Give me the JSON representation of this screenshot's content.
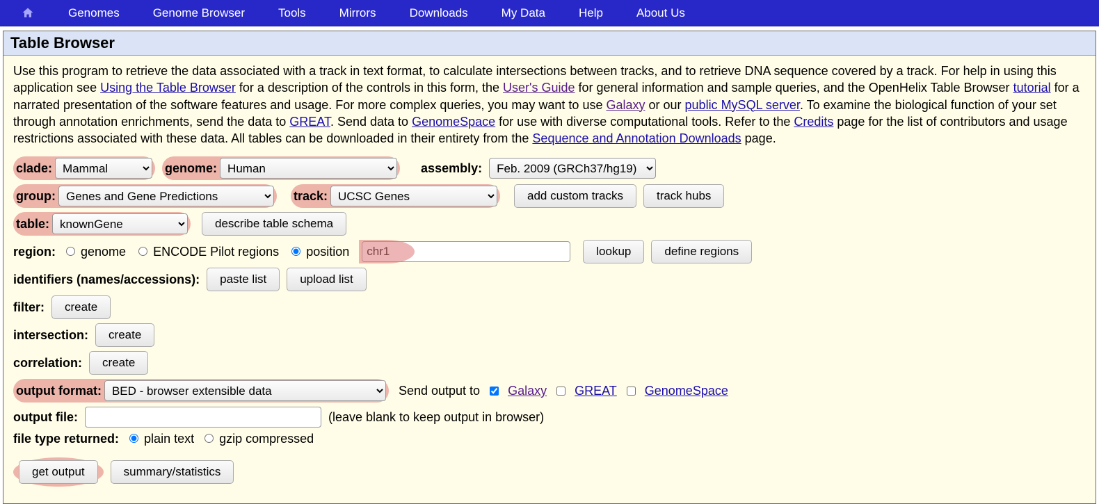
{
  "nav": [
    "Genomes",
    "Genome Browser",
    "Tools",
    "Mirrors",
    "Downloads",
    "My Data",
    "Help",
    "About Us"
  ],
  "title": "Table Browser",
  "intro": {
    "t1": "Use this program to retrieve the data associated with a track in text format, to calculate intersections between tracks, and to retrieve DNA sequence covered by a track. For help in using this application see ",
    "l1": "Using the Table Browser",
    "t2": " for a description of the controls in this form, the ",
    "l2": "User's Guide",
    "t3": " for general information and sample queries, and the OpenHelix Table Browser ",
    "l3": "tutorial",
    "t4": " for a narrated presentation of the software features and usage. For more complex queries, you may want to use ",
    "l4": "Galaxy",
    "t5": " or our ",
    "l5": "public MySQL server",
    "t6": ". To examine the biological function of your set through annotation enrichments, send the data to ",
    "l6": "GREAT",
    "t7": ". Send data to ",
    "l7": "GenomeSpace",
    "t8": " for use with diverse computational tools. Refer to the ",
    "l8": "Credits",
    "t9": " page for the list of contributors and usage restrictions associated with these data. All tables can be downloaded in their entirety from the ",
    "l9": "Sequence and Annotation Downloads",
    "t10": " page."
  },
  "labels": {
    "clade": "clade:",
    "genome": "genome:",
    "assembly": "assembly:",
    "group": "group:",
    "track": "track:",
    "add_custom": "add custom tracks",
    "track_hubs": "track hubs",
    "table": "table:",
    "describe": "describe table schema",
    "region": "region:",
    "r_genome": "genome",
    "r_encode": "ENCODE Pilot regions",
    "r_position": "position",
    "lookup": "lookup",
    "define_regions": "define regions",
    "identifiers": "identifiers (names/accessions):",
    "paste_list": "paste list",
    "upload_list": "upload list",
    "filter": "filter:",
    "create": "create",
    "intersection": "intersection:",
    "correlation": "correlation:",
    "output_format": "output format:",
    "send_output": "Send output to",
    "galaxy": "Galaxy",
    "great": "GREAT",
    "genomespace": "GenomeSpace",
    "output_file": "output file:",
    "output_file_hint": "(leave blank to keep output in browser)",
    "file_type": "file type returned:",
    "ft_plain": "plain text",
    "ft_gzip": "gzip compressed",
    "get_output": "get output",
    "summary": "summary/statistics"
  },
  "values": {
    "clade": "Mammal",
    "genome": "Human",
    "assembly": "Feb. 2009 (GRCh37/hg19)",
    "group": "Genes and Gene Predictions",
    "track": "UCSC Genes",
    "table": "knownGene",
    "position": "chr1",
    "output_format": "BED - browser extensible data",
    "output_file": ""
  }
}
